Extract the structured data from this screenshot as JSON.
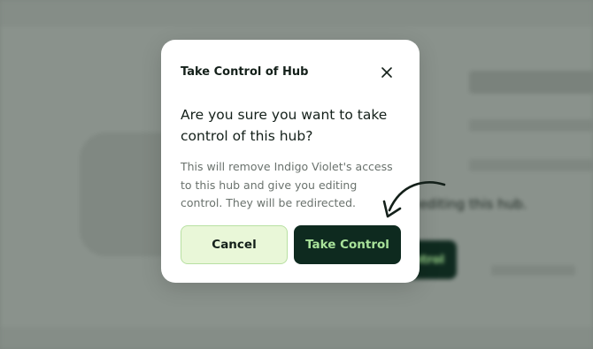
{
  "background": {
    "editing_text": "ntly editing this hub.",
    "button_label": "ntrol"
  },
  "modal": {
    "title": "Take Control of Hub",
    "question": "Are you sure you want to take control of this hub?",
    "description": "This will remove Indigo Violet's access to this hub and give you editing control. They will be redirected.",
    "cancel_label": "Cancel",
    "confirm_label": "Take Control"
  },
  "icons": {
    "close": "close-icon",
    "arrow": "curved-arrow-icon"
  },
  "colors": {
    "primary_dark": "#0e2a1f",
    "primary_text": "#a8e29a",
    "secondary_bg": "#e9f7d8",
    "overlay": "#7d857f"
  }
}
